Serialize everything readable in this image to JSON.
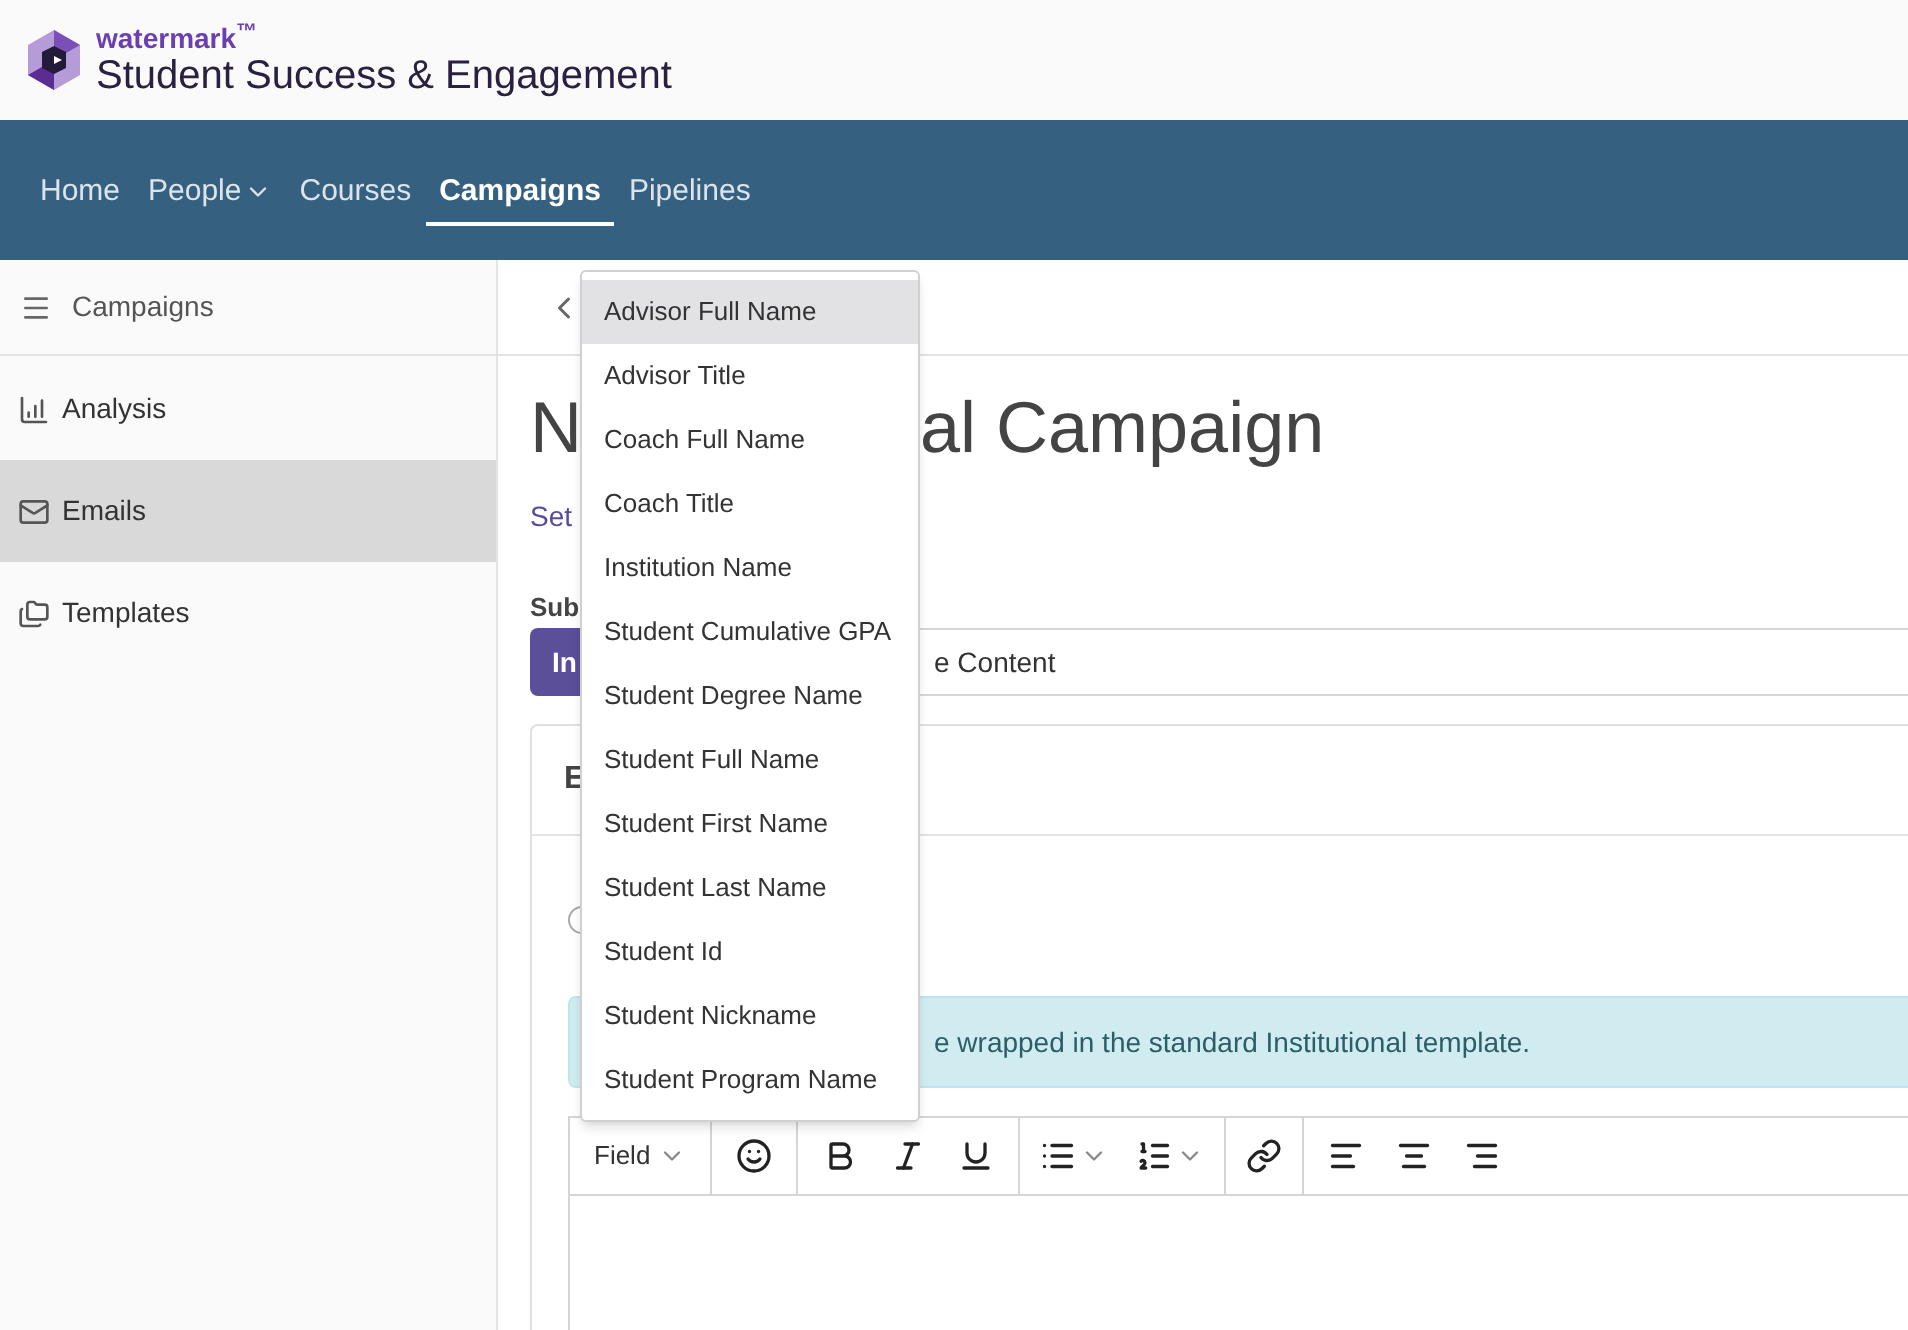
{
  "brand": {
    "logo_text": "watermark$^{™}$",
    "product": "Student Success & Engagement"
  },
  "nav": [
    {
      "label": "Home",
      "selected": false,
      "has_menu": false
    },
    {
      "label": "People",
      "selected": false,
      "has_menu": true
    },
    {
      "label": "Courses",
      "selected": false,
      "has_menu": false
    },
    {
      "label": "Campaigns",
      "selected": true,
      "has_menu": false
    },
    {
      "label": "Pipelines",
      "selected": false,
      "has_menu": false
    }
  ],
  "sidebar": {
    "title": "Campaigns",
    "items": [
      {
        "label": "Analysis",
        "selected": false
      },
      {
        "label": "Emails",
        "selected": true
      },
      {
        "label": "Templates",
        "selected": false
      }
    ]
  },
  "page": {
    "title_start": "N",
    "title_end": "al Campaign",
    "link": "Set",
    "subject_label": "Sub",
    "insert_button": "In",
    "subject_value": "e Content",
    "card_header": "E",
    "radio_selected": false,
    "notice": "e wrapped in the standard Institutional template."
  },
  "editor": {
    "field_menu": "Field"
  },
  "dropdown": {
    "items": [
      {
        "label": "Advisor Full Name",
        "selected": true
      },
      {
        "label": "Advisor Title",
        "selected": false
      },
      {
        "label": "Coach Full Name",
        "selected": false
      },
      {
        "label": "Coach Title",
        "selected": false
      },
      {
        "label": "Institution Name",
        "selected": false
      },
      {
        "label": "Student Cumulative GPA",
        "selected": false
      },
      {
        "label": "Student Degree Name",
        "selected": false
      },
      {
        "label": "Student Full Name",
        "selected": false
      },
      {
        "label": "Student First Name",
        "selected": false
      },
      {
        "label": "Student Last Name",
        "selected": false
      },
      {
        "label": "Student Id",
        "selected": false
      },
      {
        "label": "Student Nickname",
        "selected": false
      },
      {
        "label": "Student Program Name",
        "selected": false
      }
    ]
  }
}
